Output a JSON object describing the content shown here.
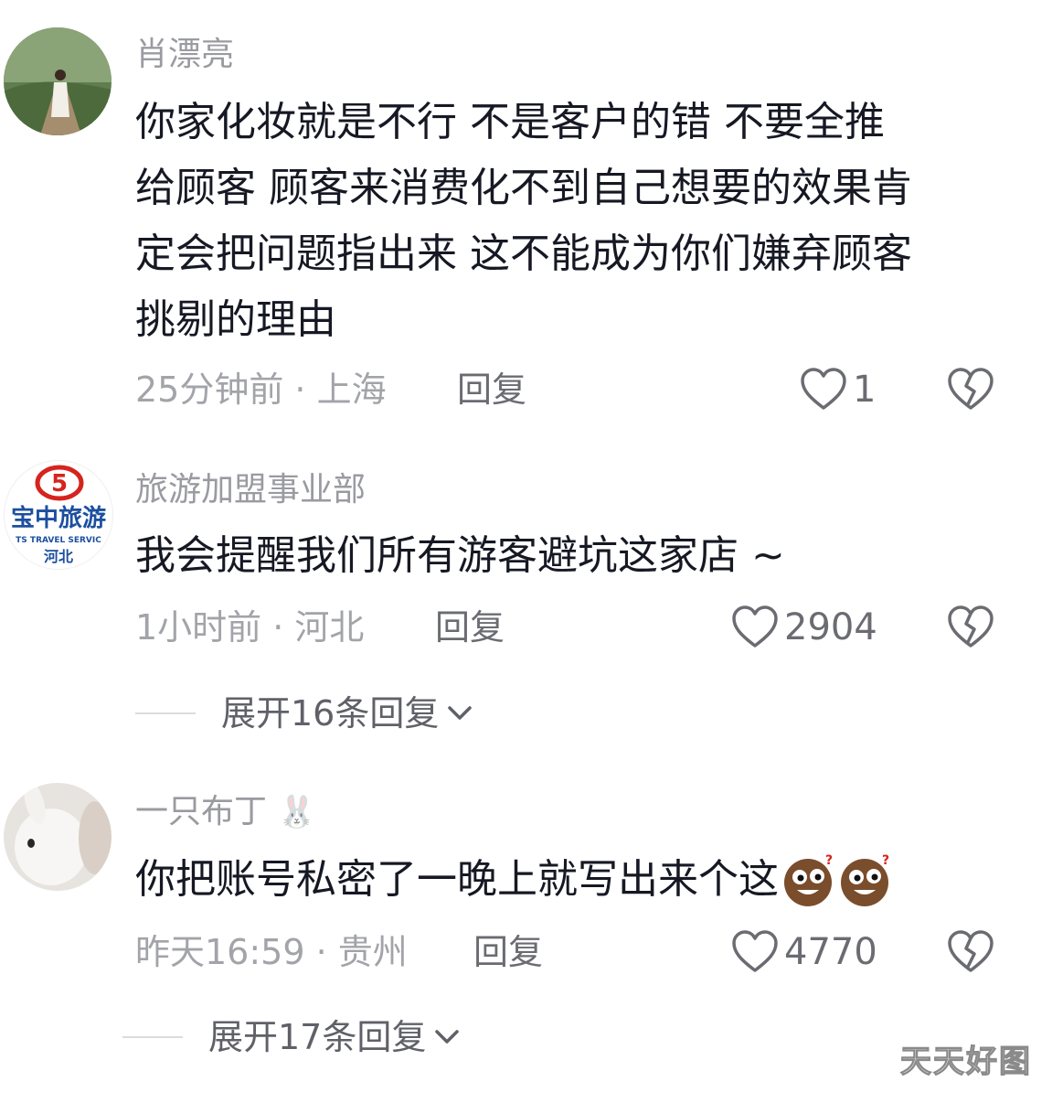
{
  "comments": [
    {
      "username": "肖漂亮",
      "lines": [
        "你家化妆就是不行 不是客户的错 不要全推",
        "给顾客 顾客来消费化不到自己想要的效果肯",
        "定会把问题指出来 这不能成为你们嫌弃顾客",
        "挑剔的理由"
      ],
      "meta": "25分钟前 · 上海",
      "reply_label": "回复",
      "likes": "1"
    },
    {
      "username": "旅游加盟事业部",
      "lines": [
        "我会提醒我们所有游客避坑这家店 ~"
      ],
      "meta": "1小时前 · 河北",
      "reply_label": "回复",
      "likes": "2904",
      "expand_label": "展开16条回复",
      "avatar_logo": {
        "text_top": "宝中旅游",
        "text_mid": "TS TRAVEL SERVIC",
        "text_bottom": "河北"
      }
    },
    {
      "username": "一只布丁",
      "username_emoji": "🐰",
      "lines": [
        "你把账号私密了一晚上就写出来个这"
      ],
      "meta": "昨天16:59 · 贵州",
      "reply_label": "回复",
      "likes": "4770",
      "expand_label": "展开17条回复"
    }
  ],
  "watermark": "天天好图",
  "colors": {
    "text": "#161823",
    "muted": "#9a9ba1",
    "action": "#6b6c72",
    "logo_red": "#d6231e",
    "logo_blue": "#1c4fa0"
  }
}
